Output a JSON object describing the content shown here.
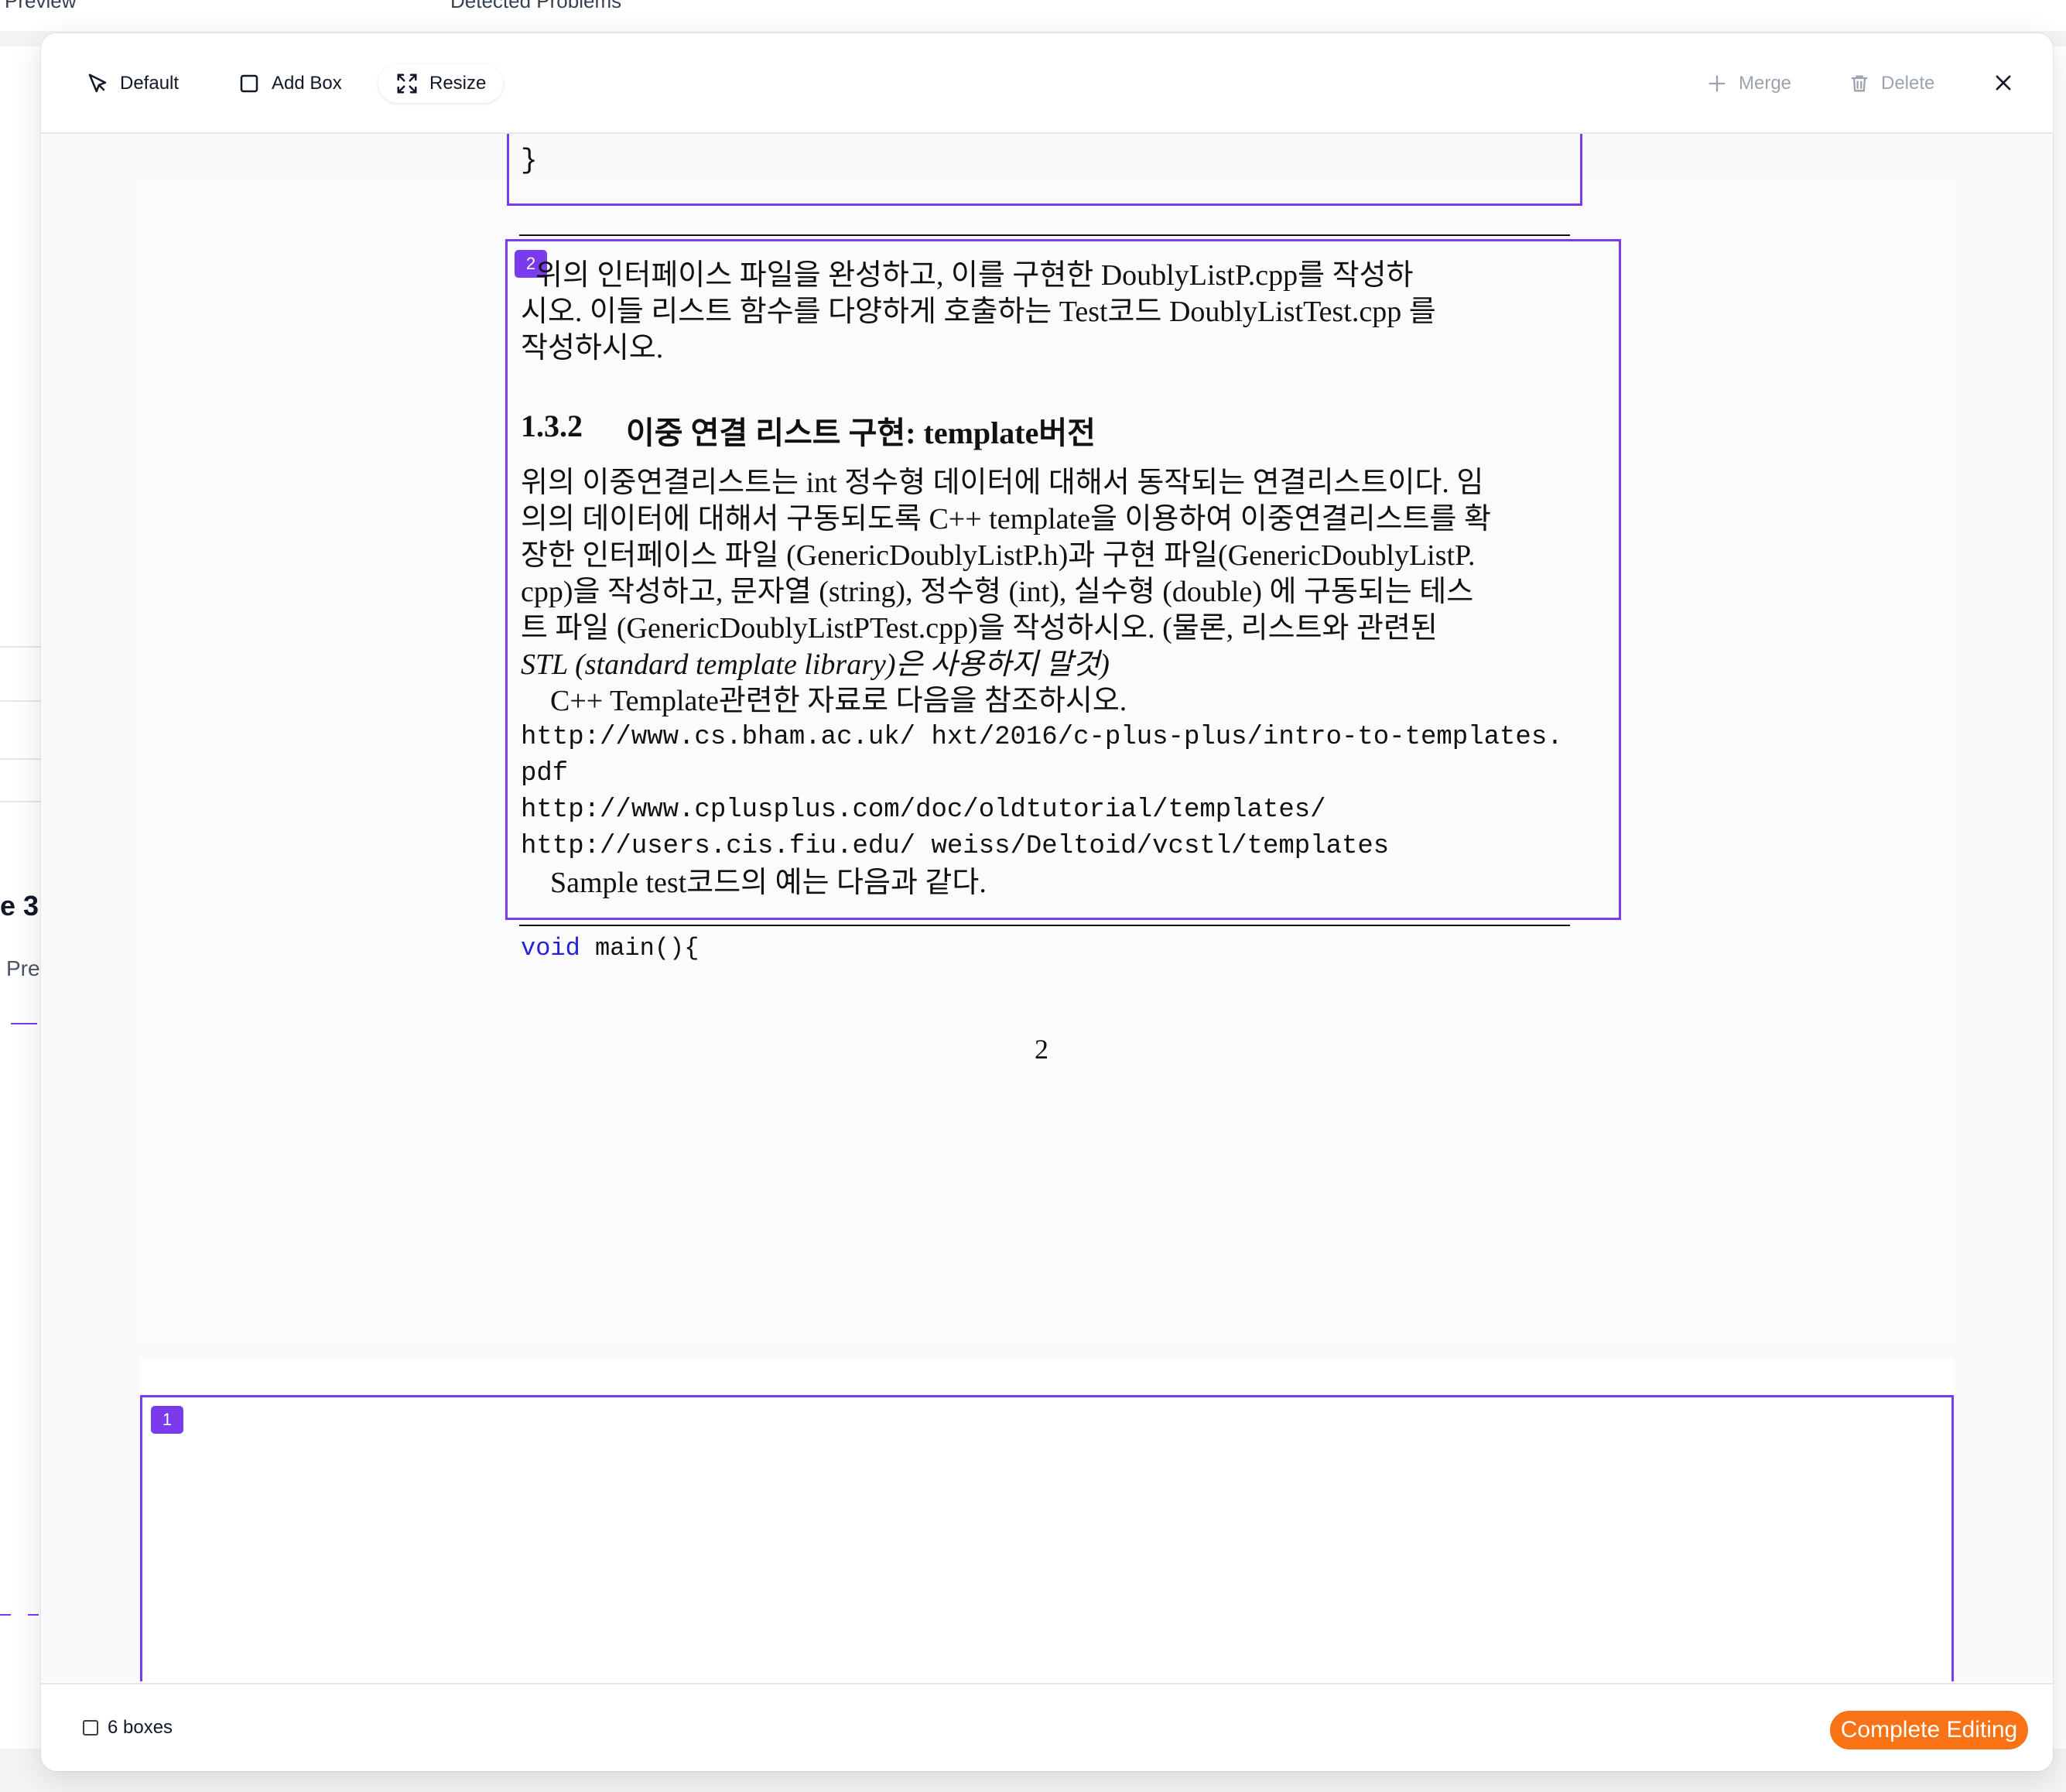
{
  "background": {
    "tab_preview": "Preview",
    "tab_problems": "Detected Problems",
    "section_title": "e 3",
    "section_sub": "Pre"
  },
  "toolbar": {
    "default_label": "Default",
    "add_box_label": "Add Box",
    "resize_label": "Resize",
    "merge_label": "Merge",
    "delete_label": "Delete"
  },
  "document": {
    "code_top_partial": "  ...",
    "code_close_brace": "}",
    "para1_line1": "  위의 인터페이스 파일을 완성하고, 이를 구현한 DoublyListP.cpp를 작성하",
    "para1_line2": "시오. 이들 리스트 함수를 다양하게 호출하는 Test코드 DoublyListTest.cpp 를",
    "para1_line3": "작성하시오.",
    "section_number": "1.3.2",
    "section_title": "이중 연결 리스트 구현: template버전",
    "body_lines": [
      "위의 이중연결리스트는 int 정수형 데이터에 대해서 동작되는 연결리스트이다. 임",
      "의의 데이터에 대해서 구동되도록 C++ template을 이용하여 이중연결리스트를 확",
      "장한 인터페이스 파일 (GenericDoublyListP.h)과 구현 파일(GenericDoublyListP.",
      "cpp)을 작성하고, 문자열 (string), 정수형 (int), 실수형 (double) 에 구동되는 테스",
      "트 파일 (GenericDoublyListPTest.cpp)을 작성하시오. (물론, 리스트와 관련된",
      "STL (standard template library)은 사용하지 말것)",
      "    C++ Template관련한 자료로 다음을 참조하시오."
    ],
    "urls": [
      "http://www.cs.bham.ac.uk/ hxt/2016/c-plus-plus/intro-to-templates.",
      "pdf",
      "http://www.cplusplus.com/doc/oldtutorial/templates/",
      "http://users.cis.fiu.edu/ weiss/Deltoid/vcstl/templates"
    ],
    "sample_line": "    Sample test코드의 예는 다음과 같다.",
    "code_void": "void",
    "code_main": " main(){",
    "page_number": "2"
  },
  "boxes": {
    "box2_badge": "2",
    "box1_badge": "1"
  },
  "footer": {
    "box_count": "6 boxes",
    "complete_label": "Complete Editing"
  },
  "colors": {
    "accent_box": "#7c3aed",
    "complete_button": "#f97316"
  }
}
